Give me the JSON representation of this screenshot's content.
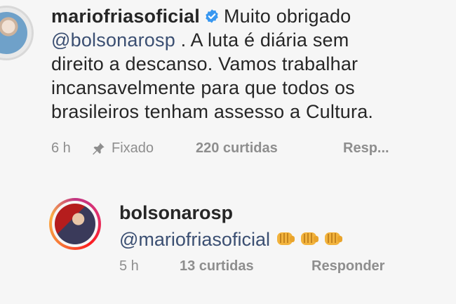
{
  "comments": [
    {
      "username": "mariofriasoficial",
      "verified": true,
      "text_lines": [
        "Muito obrigado",
        "@bolsonarosp",
        " . A luta é diária sem",
        "direito a descanso. Vamos trabalhar",
        "incansavelmente para que todos os",
        "brasileiros tenham assesso a Cultura."
      ],
      "time": "6 h",
      "pinned_label": "Fixado",
      "likes": "220 curtidas",
      "reply": "Resp..."
    },
    {
      "username": "bolsonarosp",
      "mention": "@mariofriasoficial",
      "emoji_name": "oncoming-fist-emoji",
      "emoji_count": 3,
      "time": "5 h",
      "likes": "13 curtidas",
      "reply": "Responder"
    }
  ],
  "colors": {
    "text": "#262626",
    "meta": "#8e8e8e",
    "mention": "#3b4f72",
    "verified": "#3897f0"
  },
  "icons": {
    "verified": "verified-badge-icon",
    "pin": "pin-icon"
  }
}
